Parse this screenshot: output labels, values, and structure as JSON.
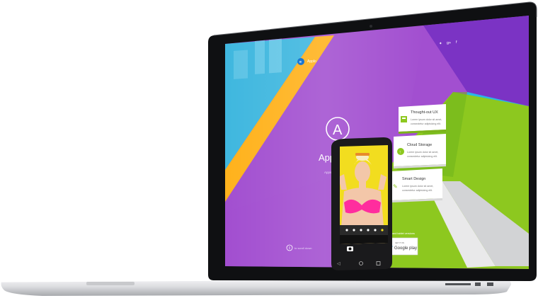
{
  "topbar": {
    "brand": "Applo",
    "social_icons": [
      "twitter-icon",
      "google-plus-icon",
      "facebook-icon"
    ]
  },
  "hero": {
    "logo_letter": "A",
    "title": "Appica",
    "tagline": "Apps. Great. Another"
  },
  "phone": {
    "camera_icon": "camera-icon",
    "nav_icons": [
      "back-icon",
      "home-icon",
      "recents-icon"
    ]
  },
  "features": [
    {
      "title": "Thought-out UX",
      "text1": "Lorem ipsum dolor sit amet,",
      "text2": "consectetur adipisicing elit.",
      "icon": "layout-icon"
    },
    {
      "title": "Cloud Storage",
      "text1": "Lorem ipsum dolor sit amet,",
      "text2": "consectetur adipisicing elit.",
      "icon": "cloud-upload-icon"
    },
    {
      "title": "Smart Design",
      "text1": "Lorem ipsum dolor sit amet,",
      "text2": "consectetur adipisicing elit.",
      "icon": "magic-wand-icon"
    }
  ],
  "download": {
    "caption": "Phone and tablet versions",
    "store_small": "GET IT ON",
    "store_label": "Google play"
  },
  "scroll_hint": "to scroll down",
  "colors": {
    "purple": "#a24fd0",
    "violet": "#7b33c4",
    "orange": "#ffb21c",
    "green": "#8dc81f",
    "cyan": "#29b6e6",
    "phone_yellow": "#f2dd1f",
    "bikini_pink": "#ff2d9e"
  }
}
